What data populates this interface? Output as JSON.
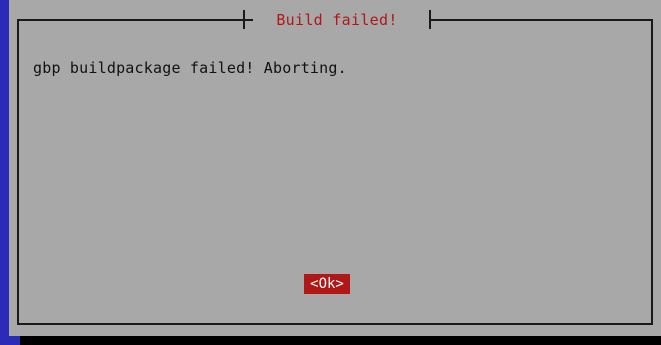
{
  "dialog": {
    "title": "Build failed!",
    "message": "gbp buildpackage failed! Aborting.",
    "ok_label": "<Ok>"
  },
  "colors": {
    "background": "#2b2bb8",
    "dialog": "#a8a8a8",
    "title": "#b01818",
    "button_bg": "#b01818",
    "button_text": "#ffffff"
  }
}
